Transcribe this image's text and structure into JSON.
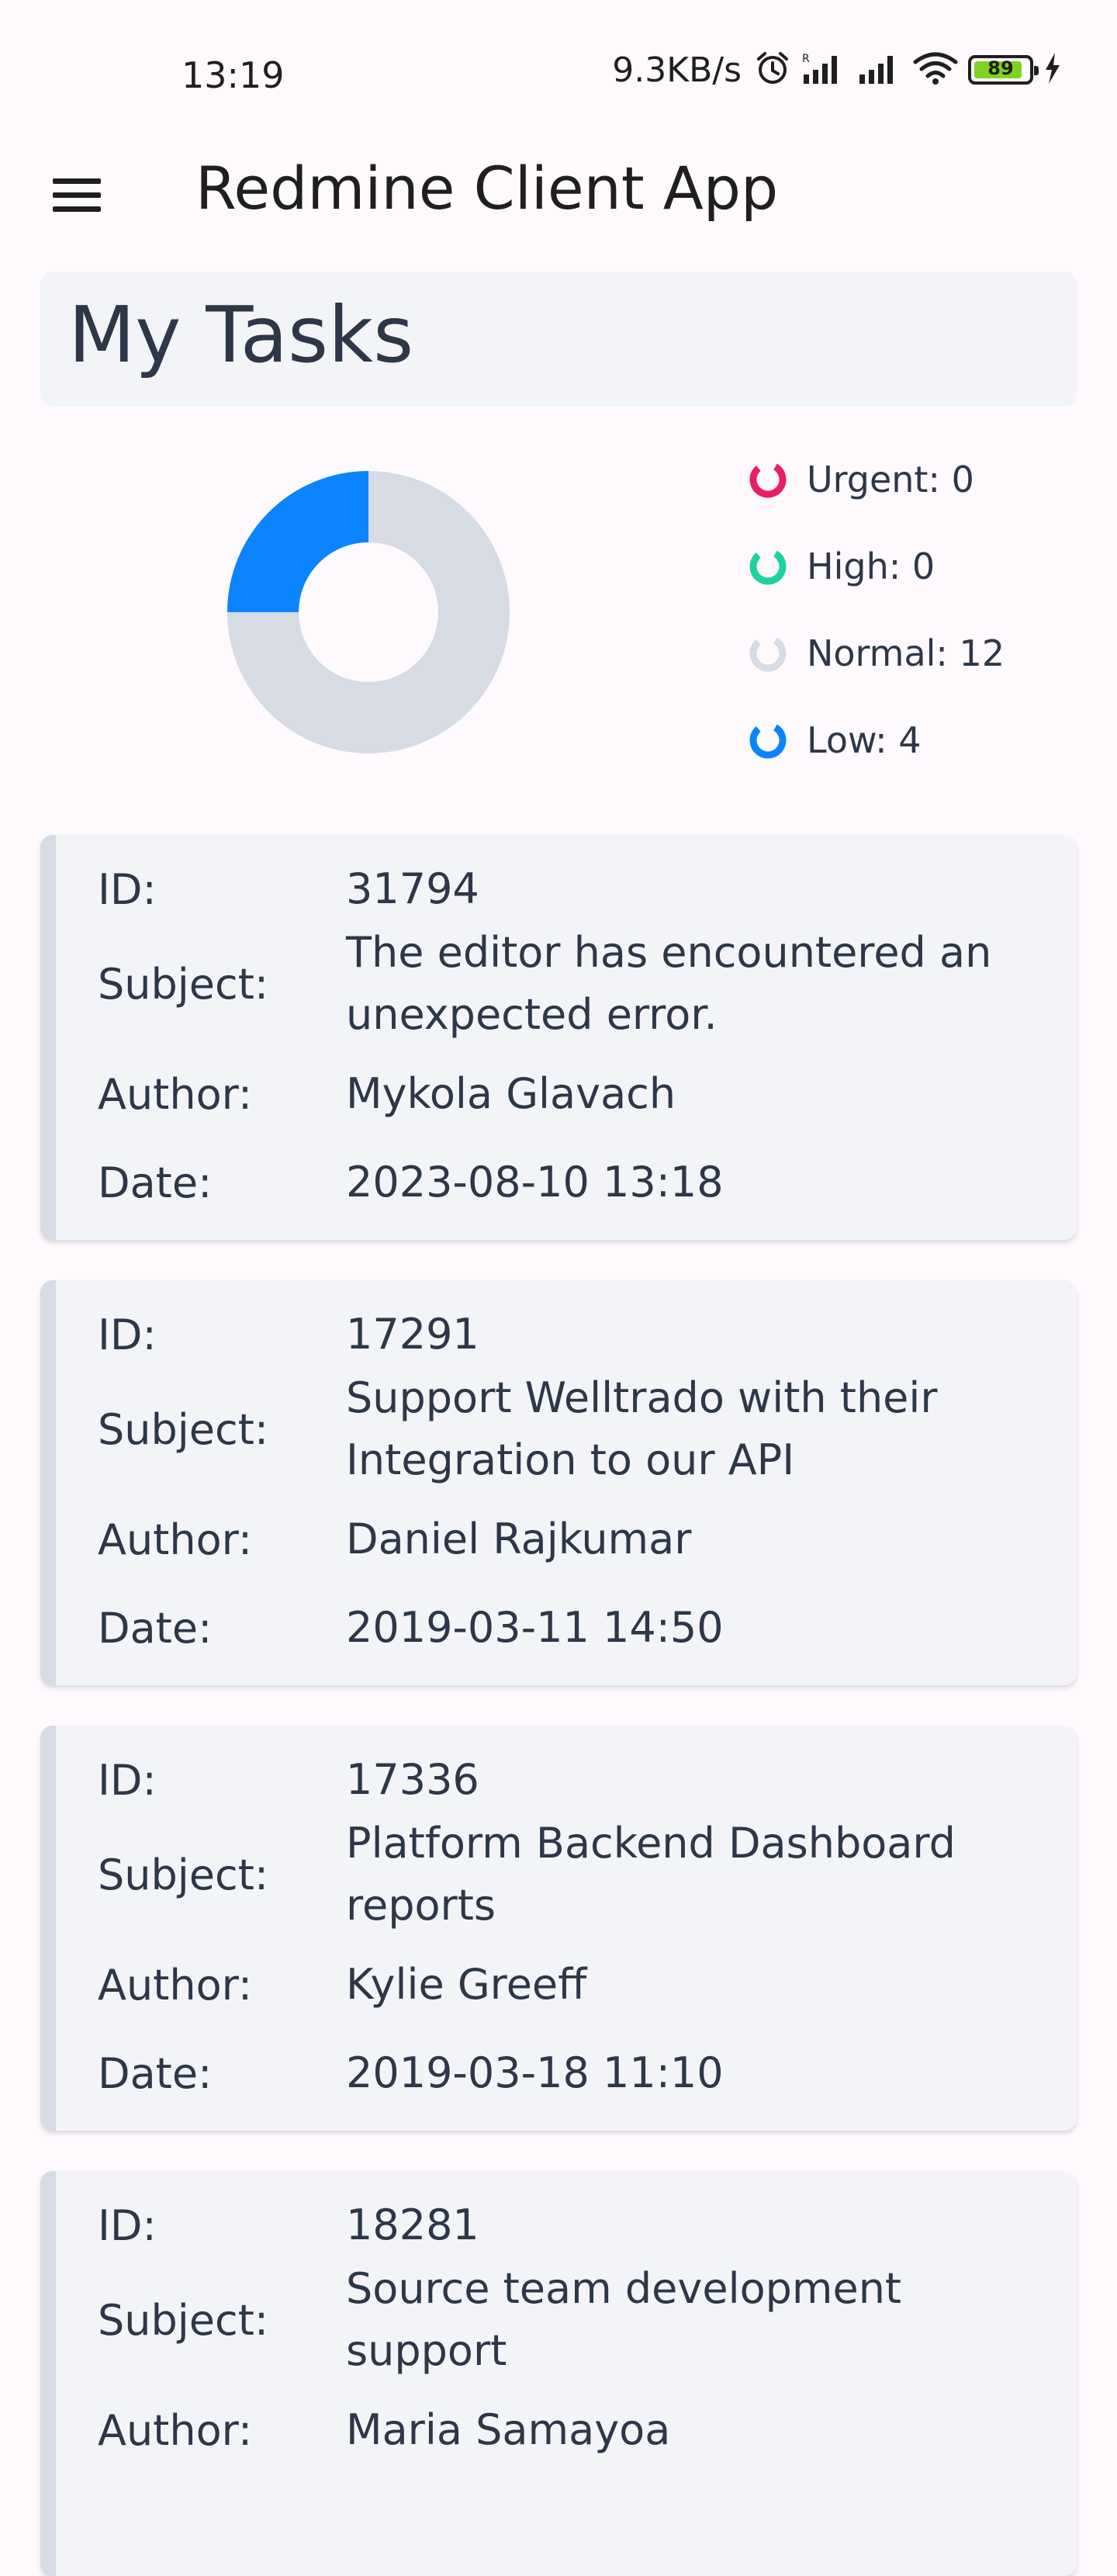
{
  "status_bar": {
    "time": "13:19",
    "network_speed": "9.3KB/s",
    "battery_level": "89",
    "icons": [
      "alarm-icon",
      "signal-icon",
      "signal-icon",
      "wifi-icon",
      "battery-icon",
      "charging-icon"
    ]
  },
  "app_bar": {
    "title": "Redmine Client App",
    "menu_icon": "hamburger-menu-icon"
  },
  "page": {
    "title": "My Tasks"
  },
  "chart_data": {
    "type": "pie",
    "categories": [
      "Urgent",
      "High",
      "Normal",
      "Low"
    ],
    "values": [
      0,
      0,
      12,
      4
    ],
    "colors": [
      "#e91e63",
      "#1dd1a1",
      "#d6dbe4",
      "#0a84ff"
    ],
    "legend": [
      "Urgent: 0",
      "High: 0",
      "Normal: 12",
      "Low: 4"
    ],
    "legend_position": "right",
    "hole": true
  },
  "labels": {
    "id": "ID:",
    "subject": "Subject:",
    "author": "Author:",
    "date": "Date:"
  },
  "tasks": [
    {
      "id": "31794",
      "subject_line1": "The editor has encountered an",
      "subject_line2": "unexpected error.",
      "author": "Mykola Glavach",
      "date": "2023-08-10 13:18"
    },
    {
      "id": "17291",
      "subject_line1": "Support Welltrado with their",
      "subject_line2": "Integration to our API",
      "author": "Daniel Rajkumar",
      "date": "2019-03-11 14:50"
    },
    {
      "id": "17336",
      "subject_line1": "Platform Backend Dashboard",
      "subject_line2": "reports",
      "author": "Kylie Greeff",
      "date": "2019-03-18 11:10"
    },
    {
      "id": "18281",
      "subject_line1": "Source team development",
      "subject_line2": "support",
      "author": "Maria Samayoa",
      "date": ""
    }
  ]
}
